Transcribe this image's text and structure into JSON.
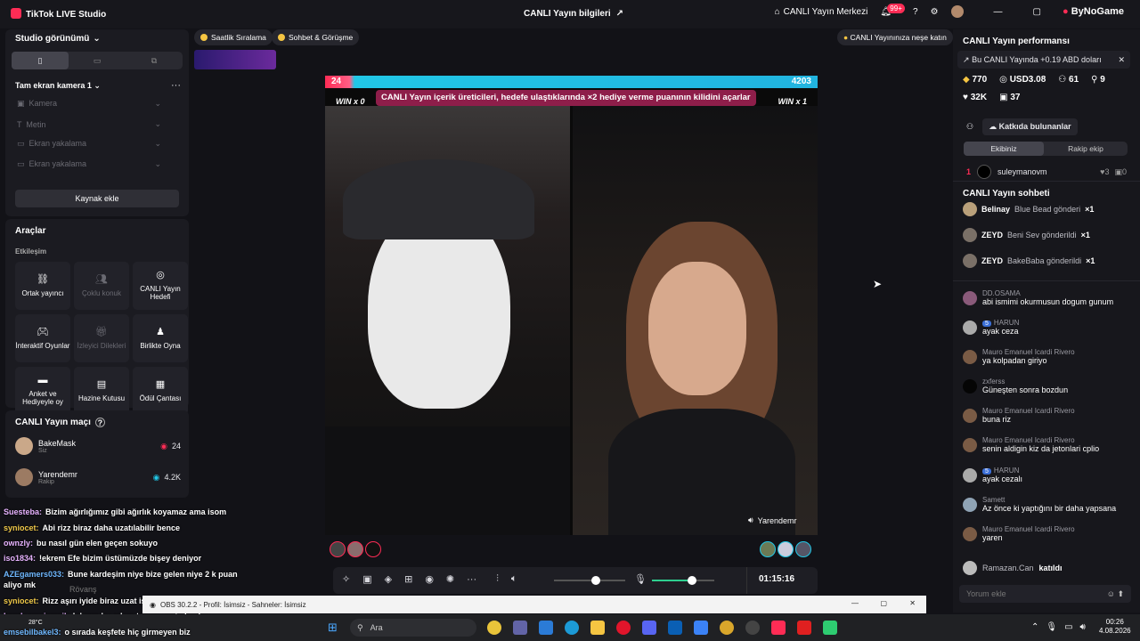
{
  "titlebar": {
    "app_name": "TikTok LIVE Studio",
    "center_title": "CANLI Yayın bilgileri",
    "live_center": "CANLI Yayın Merkezi",
    "notif_count": "99+",
    "brand": "ByNoGame"
  },
  "studio": {
    "title": "Studio görünümü",
    "scene": "Tam ekran kamera 1",
    "sources": [
      "Kamera",
      "Metin",
      "Ekran yakalama",
      "Ekran yakalama"
    ],
    "add_source": "Kaynak ekle"
  },
  "tools": {
    "title": "Araçlar",
    "section": "Etkileşim",
    "items": [
      {
        "label": "Ortak yayıncı",
        "icon": "link-icon",
        "dim": false
      },
      {
        "label": "Çoklu konuk",
        "icon": "users-icon",
        "dim": true
      },
      {
        "label": "CANLI Yayın Hedefi",
        "icon": "target-icon",
        "dim": false
      },
      {
        "label": "İnteraktif Oyunlar",
        "icon": "gamepad-icon",
        "dim": false
      },
      {
        "label": "İzleyici Dilekleri",
        "icon": "gift-icon",
        "dim": true
      },
      {
        "label": "Birlikte Oyna",
        "icon": "play-together-icon",
        "dim": false
      },
      {
        "label": "Anket ve Hediyeyle oy",
        "icon": "poll-icon",
        "dim": false
      },
      {
        "label": "Hazine Kutusu",
        "icon": "chest-icon",
        "dim": false
      },
      {
        "label": "Ödül Çantası",
        "icon": "bag-icon",
        "dim": false
      }
    ]
  },
  "match": {
    "title": "CANLI Yayın maçı",
    "players": [
      {
        "name": "BakeMask",
        "sub": "Siz",
        "score": "24"
      },
      {
        "name": "Yarendemr",
        "sub": "Rakip",
        "score": "4.2K"
      }
    ]
  },
  "overlay_chat": [
    {
      "user": "Suesteba:",
      "text": "Bizim ağırlığımız gibi ağırlık koyamaz ama isom",
      "color": "#e7b3ff"
    },
    {
      "user": "syniocet:",
      "text": "Abi rizz biraz daha uzatılabilir bence",
      "color": "#f0c94a"
    },
    {
      "user": "ownzly:",
      "text": "bu nasıl gün elen geçen sokuyo",
      "color": "#e7b3ff"
    },
    {
      "user": "iso1834:",
      "text": "!ekrem Efe bizim üstümüzde bişey deniyor",
      "color": "#e7b3ff"
    },
    {
      "user": "AZEgamers033:",
      "text": "Bune kardeşim niye bize gelen niye 2 k puan",
      "color": "#6fb8ff"
    },
    {
      "user": "",
      "text": "aliyo mk",
      "color": "#fff"
    },
    {
      "user": "syniocet:",
      "text": "Rizz aşırı iyide biraz uzat iş",
      "color": "#f0c94a"
    },
    {
      "user": "handsomeismail:",
      "text": "!ekrem bu adam taş mı yesin beyler",
      "color": "#e7b3ff"
    },
    {
      "user": "emsebilbakel3:",
      "text": "o sırada keşfete hiç girmeyen biz",
      "color": "#6fb8ff"
    }
  ],
  "overlay_misc": {
    "rovans": "Rövanş"
  },
  "top_pills": {
    "ranking": "Saatlik Sıralama",
    "chat_call": "Sohbet & Görüşme",
    "tip": "CANLI Yayınınıza neşe katın"
  },
  "video": {
    "score_left": "24",
    "score_right": "4203",
    "banner": "CANLI Yayın içerik üreticileri, hedefe ulaştıklarında ×2 hediye verme puanının kilidini açarlar",
    "win_left": "WIN x 0",
    "win_right": "WIN x 1",
    "opponent": "Yarendemr"
  },
  "controls": {
    "timer": "01:15:16"
  },
  "right": {
    "perf_title": "CANLI Yayın performansı",
    "earn_note": "Bu CANLI Yayında +0.19 ABD doları",
    "stats": {
      "diamonds": "770",
      "usd": "USD3.08",
      "viewers": "61",
      "joins": "9",
      "likes": "32K",
      "gifts": "37"
    },
    "contrib": "Katkıda bulunanlar",
    "tabs": [
      "Ekibiniz",
      "Rakip ekip"
    ],
    "top_contrib": {
      "rank": "1",
      "name": "suleymanovm",
      "likes": "3",
      "gifts": "0"
    },
    "chat_title": "CANLI Yayın sohbeti",
    "gifts": [
      {
        "name": "Belinay",
        "text": "Blue Bead gönderi",
        "count": "×1"
      },
      {
        "name": "ZEYD",
        "text": "Beni Sev gönderildi",
        "count": "×1"
      },
      {
        "name": "ZEYD",
        "text": "BakeBaba gönderildi",
        "count": "×1"
      }
    ],
    "messages": [
      {
        "name": "DD.OSAMA",
        "text": "abi ismimi okurmusun dogum gunum",
        "lvl": ""
      },
      {
        "name": "HARUN",
        "text": "ayak ceza",
        "lvl": "5"
      },
      {
        "name": "Mauro Emanuel Icardi Rivero",
        "text": "ya kolpadan giriyo",
        "lvl": ""
      },
      {
        "name": "zxferss",
        "text": "Güneşten sonra bozdun",
        "lvl": ""
      },
      {
        "name": "Mauro Emanuel Icardi Rivero",
        "text": "buna riz",
        "lvl": ""
      },
      {
        "name": "Mauro Emanuel Icardi Rivero",
        "text": "senin aldigin kiz da jetonlari cplio",
        "lvl": ""
      },
      {
        "name": "HARUN",
        "text": "ayak cezalı",
        "lvl": "5"
      },
      {
        "name": "Samett",
        "text": "Az önce ki yaptığını bir daha yapsana",
        "lvl": ""
      },
      {
        "name": "Mauro Emanuel Icardi Rivero",
        "text": "yaren",
        "lvl": ""
      }
    ],
    "joined": {
      "name": "Ramazan.Can",
      "text": "katıldı"
    },
    "comment_placeholder": "Yorum ekle"
  },
  "subwindow": {
    "title": "OBS 30.2.2 - Profil: İsimsiz - Sahneler: İsimsiz"
  },
  "taskbar": {
    "weather": "28°C",
    "search": "Ara",
    "time": "00:26",
    "date": "4.08.2026"
  }
}
